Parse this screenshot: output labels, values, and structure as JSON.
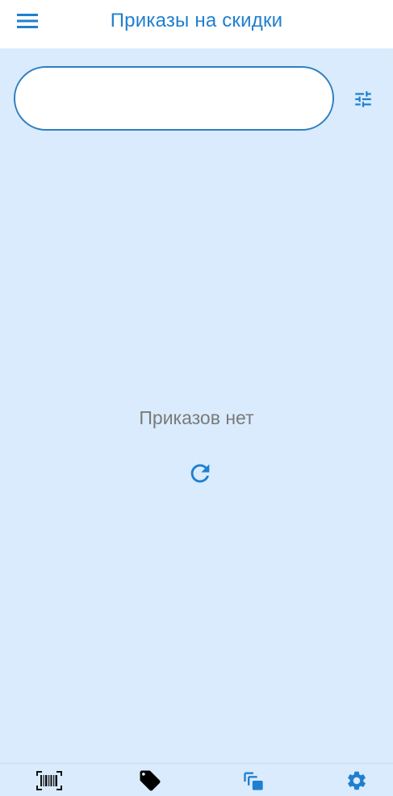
{
  "header": {
    "title": "Приказы на скидки",
    "menu_icon": "hamburger-menu-icon"
  },
  "search": {
    "value": "",
    "placeholder": "",
    "filter_icon": "filter-sliders-icon"
  },
  "main": {
    "empty_message": "Приказов нет",
    "refresh_icon": "refresh-icon"
  },
  "bottom_nav": {
    "items": [
      {
        "icon": "barcode-scanner-icon",
        "active": false
      },
      {
        "icon": "tag-icon",
        "active": true
      },
      {
        "icon": "copy-layers-icon",
        "active": false
      },
      {
        "icon": "gear-icon",
        "active": false
      }
    ]
  },
  "colors": {
    "accent": "#1f7fcf",
    "background": "#d9ebfd",
    "header_background": "#ffffff",
    "muted_text": "#7a7a7a",
    "active_nav_icon": "#000000"
  }
}
